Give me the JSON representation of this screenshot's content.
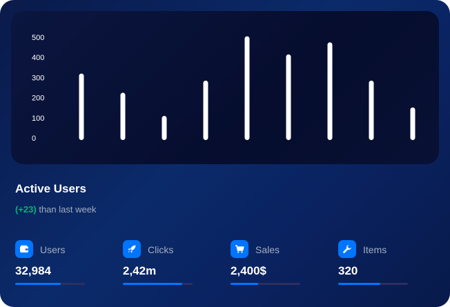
{
  "chart_data": {
    "type": "bar",
    "categories": [
      "",
      "",
      "",
      "",
      "",
      "",
      "",
      "",
      ""
    ],
    "values": [
      330,
      235,
      120,
      295,
      515,
      425,
      485,
      295,
      162
    ],
    "ylim": [
      0,
      500
    ],
    "yticks": [
      "0",
      "100",
      "200",
      "300",
      "400",
      "500"
    ],
    "grid": false,
    "bar_color": "#ffffff"
  },
  "header": {
    "title": "Active Users",
    "change": "(+23)",
    "change_text": " than last week"
  },
  "stats": [
    {
      "label": "Users",
      "value": "32,984",
      "progress": 0.65,
      "icon": "wallet-icon"
    },
    {
      "label": "Clicks",
      "value": "2,42m",
      "progress": 0.85,
      "icon": "rocket-icon"
    },
    {
      "label": "Sales",
      "value": "2,400$",
      "progress": 0.4,
      "icon": "cart-icon"
    },
    {
      "label": "Items",
      "value": "320",
      "progress": 0.6,
      "icon": "wrench-icon"
    }
  ],
  "colors": {
    "accent": "#0075ff",
    "positive": "#01b574",
    "muted": "#a0aec0"
  }
}
